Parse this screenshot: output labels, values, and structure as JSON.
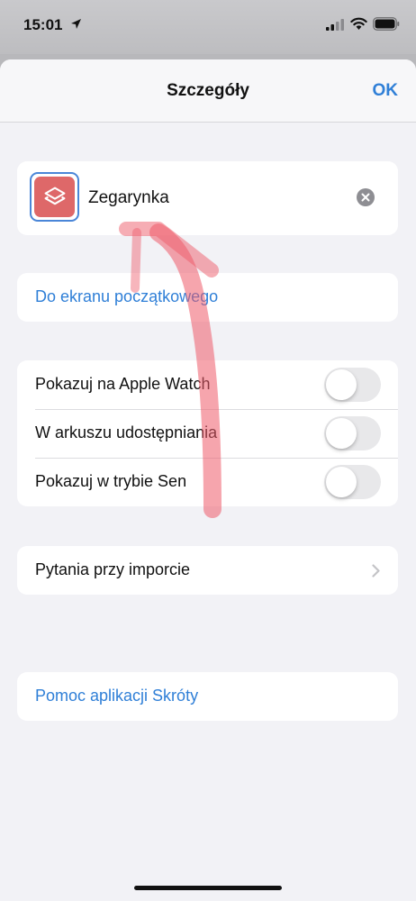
{
  "status_bar": {
    "time": "15:01",
    "icons": [
      "location-arrow-icon",
      "cellular-signal-icon",
      "wifi-icon",
      "battery-icon"
    ]
  },
  "nav": {
    "title": "Szczegóły",
    "ok_label": "OK"
  },
  "shortcut": {
    "name": "Zegarynka",
    "icon": "shortcuts-app-icon",
    "icon_color": "#de6869"
  },
  "home_screen_link": "Do ekranu początkowego",
  "toggles": [
    {
      "label": "Pokazuj na Apple Watch",
      "on": false
    },
    {
      "label": "W arkuszu udostępniania",
      "on": false
    },
    {
      "label": "Pokazuj w trybie Sen",
      "on": false
    }
  ],
  "import_questions": "Pytania przy imporcie",
  "help_link": "Pomoc aplikacji Skróty",
  "colors": {
    "accent": "#2f7fd7",
    "annotation": "#ee5b6a"
  }
}
